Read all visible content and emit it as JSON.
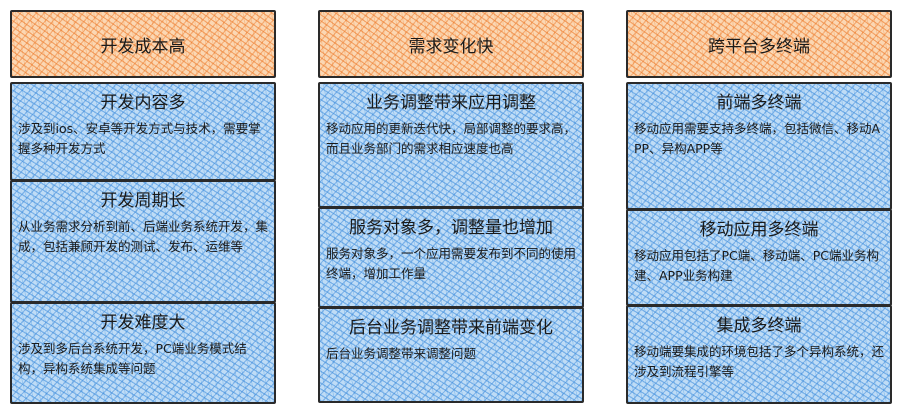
{
  "columns": [
    {
      "header": "开发成本高",
      "cards": [
        {
          "title": "开发内容多",
          "desc": "涉及到ios、安卓等开发方式与技术，需要掌握多种开发方式"
        },
        {
          "title": "开发周期长",
          "desc": "从业务需求分析到前、后端业务系统开发，集成，包括兼顾开发的测试、发布、运维等"
        },
        {
          "title": "开发难度大",
          "desc": "涉及到多后台系统开发，PC端业务模式结构，异构系统集成等问题"
        }
      ]
    },
    {
      "header": "需求变化快",
      "cards": [
        {
          "title": "业务调整带来应用调整",
          "desc": "移动应用的更新迭代快，局部调整的要求高，而且业务部门的需求相应速度也高"
        },
        {
          "title": "服务对象多，调整量也增加",
          "desc": "服务对象多，一个应用需要发布到不同的使用终端，增加工作量"
        },
        {
          "title": "后台业务调整带来前端变化",
          "desc": "后台业务调整带来调整问题"
        }
      ]
    },
    {
      "header": "跨平台多终端",
      "cards": [
        {
          "title": "前端多终端",
          "desc": "移动应用需要支持多终端，包括微信、移动APP、异构APP等"
        },
        {
          "title": "移动应用多终端",
          "desc": "移动应用包括了PC端、移动端、PC端业务构建、APP业务构建"
        },
        {
          "title": "集成多终端",
          "desc": "移动端要集成的环境包括了多个异构系统，还涉及到流程引擎等"
        }
      ]
    }
  ]
}
